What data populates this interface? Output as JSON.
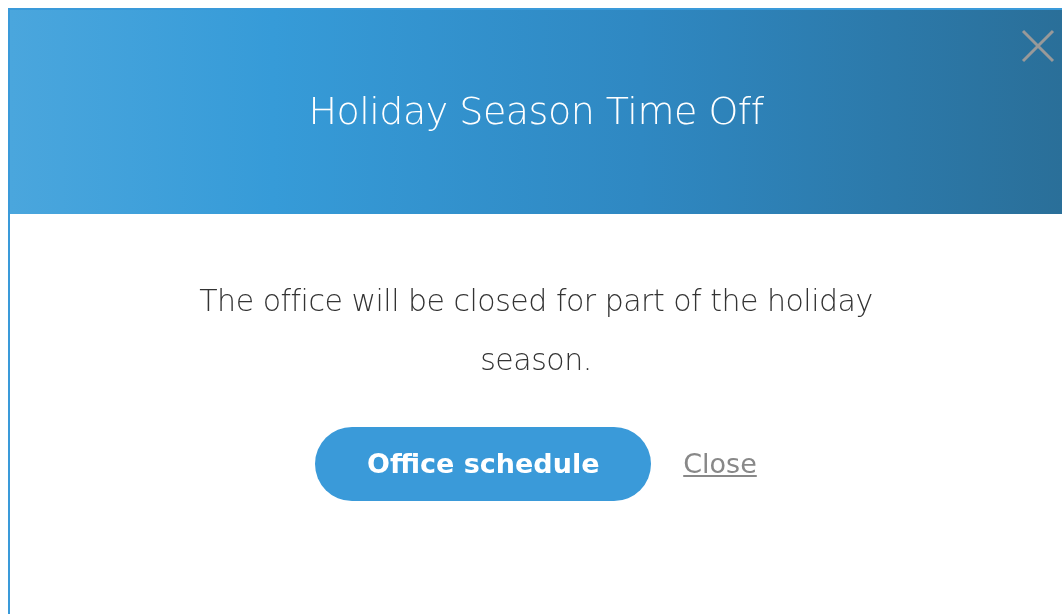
{
  "dialog": {
    "title": "Holiday Season Time Off",
    "message": "The office will be closed for part of the holiday season.",
    "primary_button": "Office schedule",
    "link": "Close"
  }
}
